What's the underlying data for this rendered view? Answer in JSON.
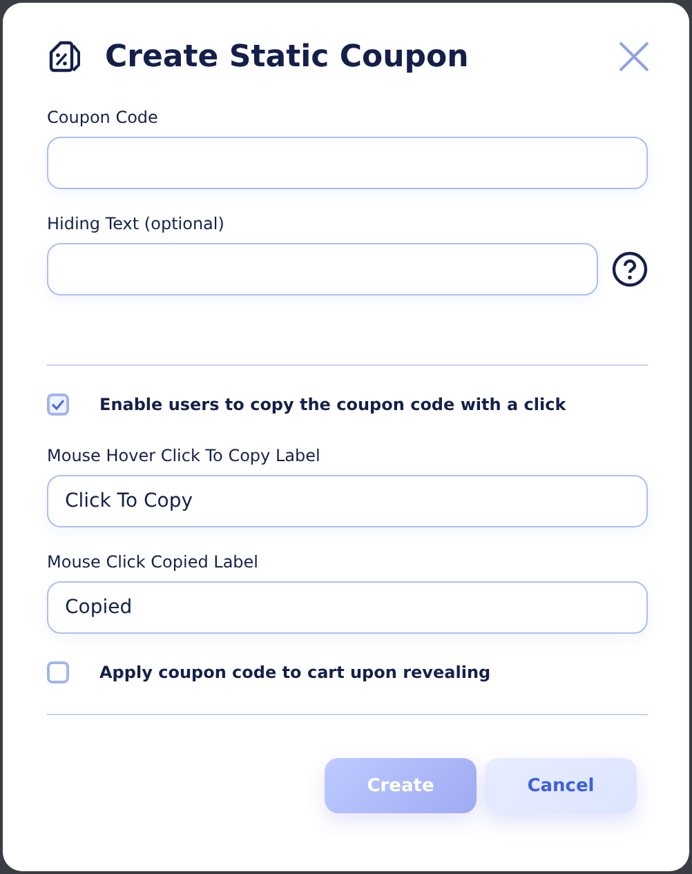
{
  "dialog": {
    "title": "Create Static Coupon"
  },
  "fields": [
    {
      "label": "Coupon Code",
      "help": false
    },
    {
      "label": "Hiding Text (optional)",
      "help": true
    }
  ],
  "copy_option": {
    "label": "Enable users to copy the coupon code with a click",
    "checked": true
  },
  "copy_fields": [
    {
      "label": "Mouse Hover Click To Copy Label",
      "value": "Click To Copy"
    },
    {
      "label": "Mouse Click Copied Label",
      "value": "Copied"
    }
  ],
  "apply_option": {
    "label": "Apply coupon code to cart upon revealing",
    "checked": false
  },
  "buttons": [
    {
      "label": "Create",
      "kind": "primary",
      "disabled": true
    },
    {
      "label": "Cancel",
      "kind": "secondary",
      "disabled": false
    }
  ]
}
